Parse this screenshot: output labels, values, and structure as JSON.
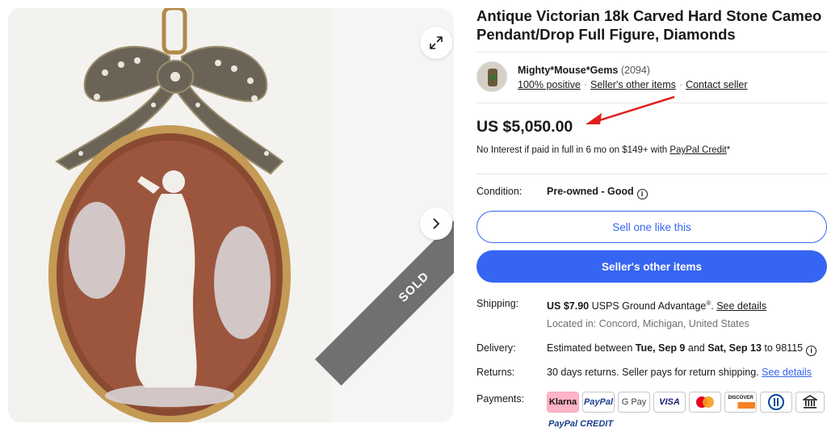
{
  "listing": {
    "title": "Antique Victorian 18k Carved Hard Stone Cameo Pendant/Drop Full Figure, Diamonds",
    "sold_label": "SOLD"
  },
  "seller": {
    "name": "Mighty*Mouse*Gems",
    "count": "(2094)",
    "positive": "100% positive",
    "other_items": "Seller's other items",
    "contact": "Contact seller"
  },
  "price": {
    "amount": "US $5,050.00",
    "credit_text": "No Interest if paid in full in 6 mo on $149+ with ",
    "credit_link": "PayPal Credit",
    "credit_suffix": "*"
  },
  "condition": {
    "label": "Condition:",
    "value": "Pre-owned - Good"
  },
  "buttons": {
    "sell_one": "Sell one like this",
    "sellers_other": "Seller's other items"
  },
  "shipping": {
    "label": "Shipping:",
    "cost": "US $7.90",
    "service": " USPS Ground Advantage",
    "reg": "®",
    "period": ". ",
    "details": "See details",
    "location": "Located in: Concord, Michigan, United States"
  },
  "delivery": {
    "label": "Delivery:",
    "prefix": "Estimated between ",
    "start": "Tue, Sep 9",
    "and": " and ",
    "end": "Sat, Sep 13",
    "to": " to 98115"
  },
  "returns": {
    "label": "Returns:",
    "text": "30 days returns. Seller pays for return shipping. ",
    "details": "See details"
  },
  "payments": {
    "label": "Payments:",
    "methods": [
      "Klarna",
      "PayPal",
      "G Pay",
      "VISA",
      "",
      "DISCOVER",
      "",
      ""
    ],
    "paypal_credit": "PayPal CREDIT"
  },
  "colors": {
    "accent": "#3665f3",
    "annotation_arrow": "#e0201e"
  }
}
